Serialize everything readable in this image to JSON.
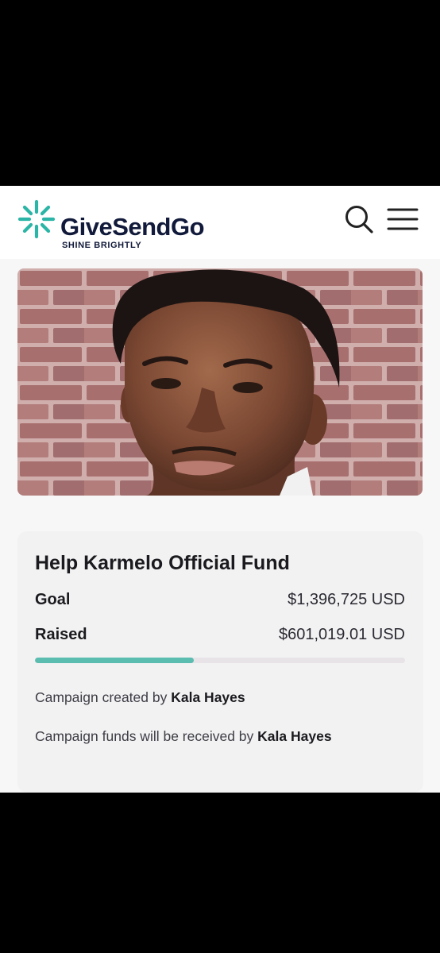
{
  "header": {
    "brand_name": "GiveSendGo",
    "tagline": "SHINE BRIGHTLY",
    "search_icon": "search-icon",
    "menu_icon": "hamburger-menu-icon"
  },
  "colors": {
    "brand_teal": "#2bb5a6",
    "brand_navy": "#111a3a",
    "progress": "#5bbcb0"
  },
  "campaign": {
    "title": "Help Karmelo Official Fund",
    "goal_label": "Goal",
    "goal_value": "$1,396,725 USD",
    "raised_label": "Raised",
    "raised_value": "$601,019.01 USD",
    "progress_fraction": 0.43,
    "created_prefix": "Campaign created by",
    "created_name": "Kala Hayes",
    "funds_prefix": "Campaign funds will be received by",
    "funds_name": "Kala Hayes"
  }
}
